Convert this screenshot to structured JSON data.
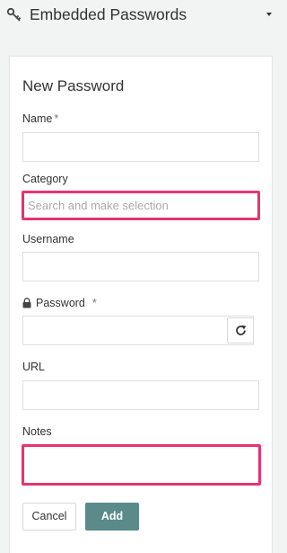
{
  "header": {
    "title": "Embedded Passwords",
    "icon": "key-icon",
    "dropdown_icon": "caret-down-icon"
  },
  "form": {
    "title": "New Password",
    "name": {
      "label": "Name",
      "required_mark": "*",
      "value": ""
    },
    "category": {
      "label": "Category",
      "placeholder": "Search and make selection",
      "value": ""
    },
    "username": {
      "label": "Username",
      "value": ""
    },
    "password": {
      "label": "Password",
      "required_mark": "*",
      "value": "",
      "lock_icon": "lock-icon",
      "refresh_icon": "refresh-icon"
    },
    "url": {
      "label": "URL",
      "value": ""
    },
    "notes": {
      "label": "Notes",
      "value": ""
    }
  },
  "actions": {
    "cancel_label": "Cancel",
    "add_label": "Add"
  },
  "colors": {
    "highlight": "#e8336f",
    "primary": "#5b8a8a",
    "background": "#f2f3f3"
  }
}
